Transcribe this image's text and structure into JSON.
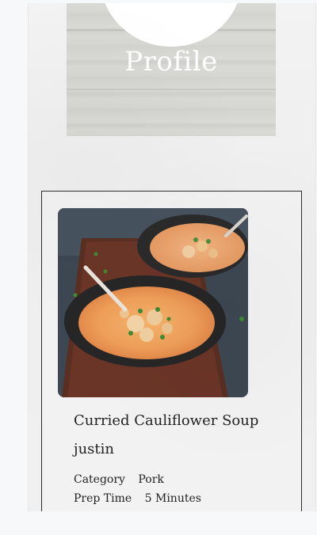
{
  "header": {
    "title": "Profile"
  },
  "recipe": {
    "title": "Curried Cauliflower Soup",
    "author": "justin",
    "image_icon": "soup-photo",
    "category_label": "Category",
    "category_value": "Pork",
    "prep_label": "Prep Time",
    "prep_value": "5 Minutes"
  }
}
